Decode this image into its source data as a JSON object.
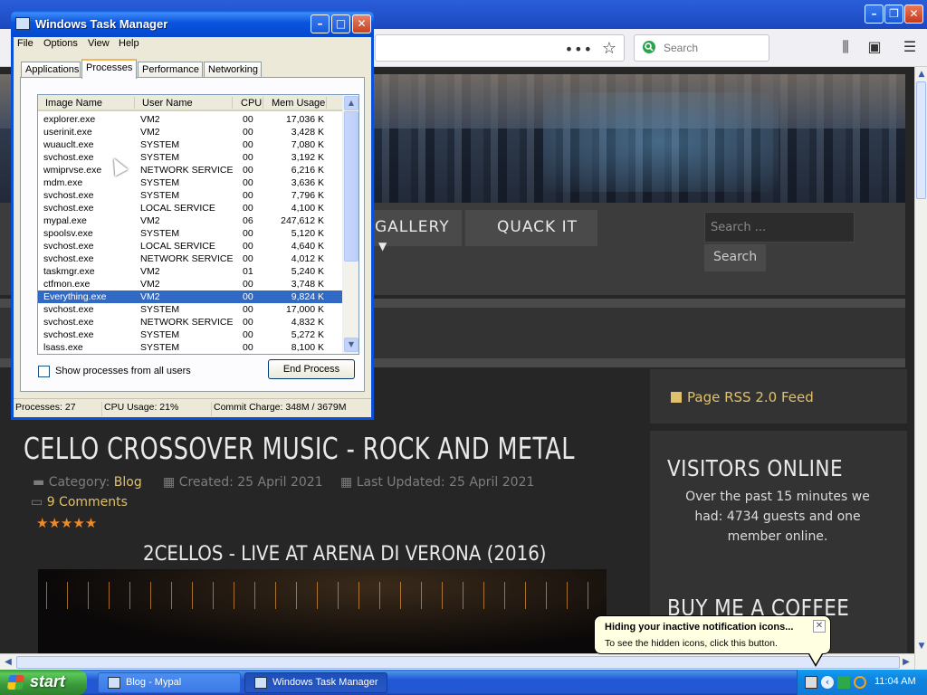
{
  "browser": {
    "search_placeholder": "Search",
    "page": {
      "nav": {
        "gallery": "GALLERY",
        "quack": "QUACK IT",
        "search_placeholder": "Search ...",
        "search_button": "Search"
      },
      "article": {
        "title": "CELLO CROSSOVER MUSIC - ROCK AND METAL",
        "category_label": "Category:",
        "category_value": "Blog",
        "created": "Created: 25 April 2021",
        "updated": "Last Updated: 25 April 2021",
        "comments": "9 Comments",
        "rating_stars": 5,
        "video_title": "2CELLOS - LIVE AT ARENA DI VERONA (2016)"
      },
      "sidebar": {
        "rss": "Page RSS 2.0 Feed",
        "visitors_heading": "VISITORS ONLINE",
        "visitors_text": "Over the past 15 minutes we had: 4734 guests and one member online.",
        "coffee_heading": "BUY ME A COFFEE"
      }
    }
  },
  "task_manager": {
    "title": "Windows Task Manager",
    "menu": [
      "File",
      "Options",
      "View",
      "Help"
    ],
    "tabs": [
      "Applications",
      "Processes",
      "Performance",
      "Networking"
    ],
    "active_tab": "Processes",
    "columns": [
      "Image Name",
      "User Name",
      "CPU",
      "Mem Usage"
    ],
    "processes": [
      {
        "name": "explorer.exe",
        "user": "VM2",
        "cpu": "00",
        "mem": "17,036 K"
      },
      {
        "name": "userinit.exe",
        "user": "VM2",
        "cpu": "00",
        "mem": "3,428 K"
      },
      {
        "name": "wuauclt.exe",
        "user": "SYSTEM",
        "cpu": "00",
        "mem": "7,080 K"
      },
      {
        "name": "svchost.exe",
        "user": "SYSTEM",
        "cpu": "00",
        "mem": "3,192 K"
      },
      {
        "name": "wmiprvse.exe",
        "user": "NETWORK SERVICE",
        "cpu": "00",
        "mem": "6,216 K"
      },
      {
        "name": "mdm.exe",
        "user": "SYSTEM",
        "cpu": "00",
        "mem": "3,636 K"
      },
      {
        "name": "svchost.exe",
        "user": "SYSTEM",
        "cpu": "00",
        "mem": "7,796 K"
      },
      {
        "name": "svchost.exe",
        "user": "LOCAL SERVICE",
        "cpu": "00",
        "mem": "4,100 K"
      },
      {
        "name": "mypal.exe",
        "user": "VM2",
        "cpu": "06",
        "mem": "247,612 K"
      },
      {
        "name": "spoolsv.exe",
        "user": "SYSTEM",
        "cpu": "00",
        "mem": "5,120 K"
      },
      {
        "name": "svchost.exe",
        "user": "LOCAL SERVICE",
        "cpu": "00",
        "mem": "4,640 K"
      },
      {
        "name": "svchost.exe",
        "user": "NETWORK SERVICE",
        "cpu": "00",
        "mem": "4,012 K"
      },
      {
        "name": "taskmgr.exe",
        "user": "VM2",
        "cpu": "01",
        "mem": "5,240 K"
      },
      {
        "name": "ctfmon.exe",
        "user": "VM2",
        "cpu": "00",
        "mem": "3,748 K"
      },
      {
        "name": "Everything.exe",
        "user": "VM2",
        "cpu": "00",
        "mem": "9,824 K",
        "selected": true
      },
      {
        "name": "svchost.exe",
        "user": "SYSTEM",
        "cpu": "00",
        "mem": "17,000 K"
      },
      {
        "name": "svchost.exe",
        "user": "NETWORK SERVICE",
        "cpu": "00",
        "mem": "4,832 K"
      },
      {
        "name": "svchost.exe",
        "user": "SYSTEM",
        "cpu": "00",
        "mem": "5,272 K"
      },
      {
        "name": "lsass.exe",
        "user": "SYSTEM",
        "cpu": "00",
        "mem": "8,100 K"
      }
    ],
    "show_all_users_label": "Show processes from all users",
    "show_all_users_checked": false,
    "end_process_label": "End Process",
    "status": {
      "processes": "Processes: 27",
      "cpu": "CPU Usage: 21%",
      "commit": "Commit Charge: 348M / 3679M"
    }
  },
  "balloon": {
    "title": "Hiding your inactive notification icons...",
    "body": "To see the hidden icons, click this button."
  },
  "taskbar": {
    "start_label": "start",
    "buttons": [
      {
        "label": "Blog - Mypal",
        "active": false
      },
      {
        "label": "Windows Task Manager",
        "active": true
      }
    ],
    "clock": "11:04 AM"
  }
}
